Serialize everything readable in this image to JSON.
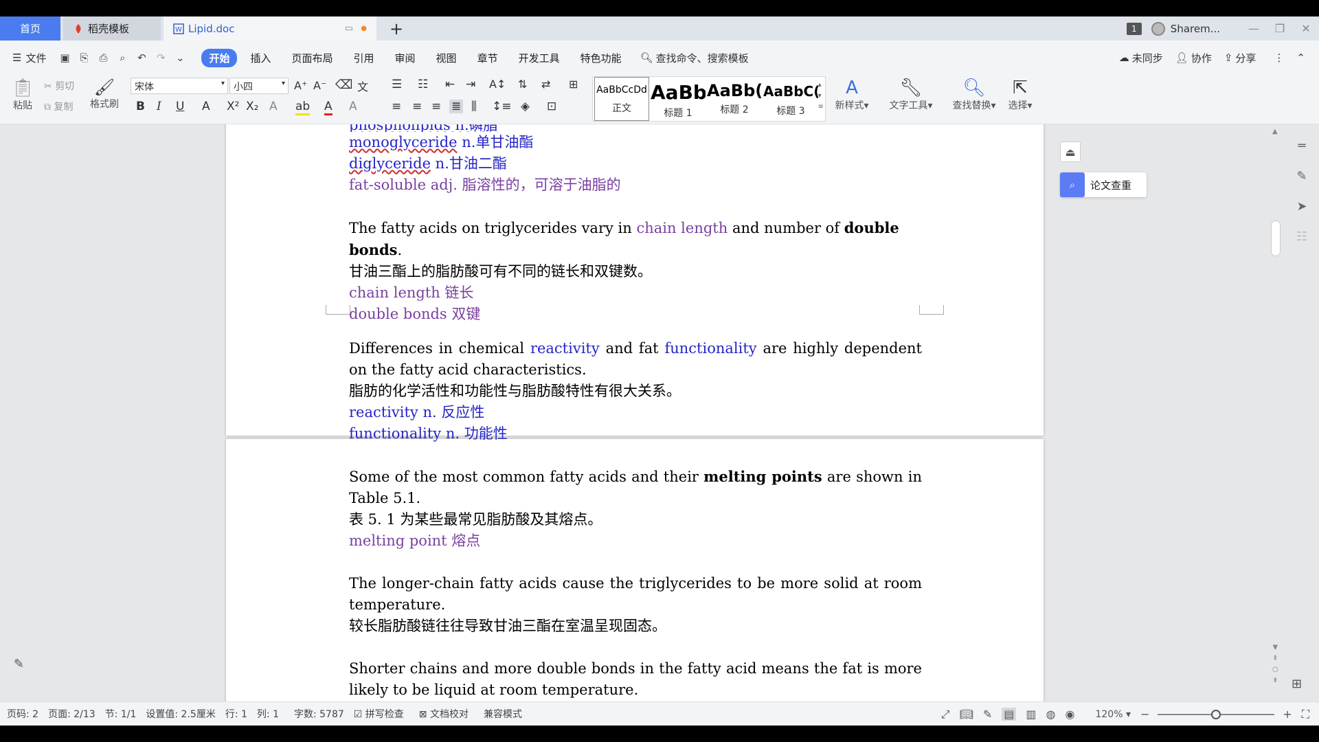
{
  "tabs": {
    "home": "首页",
    "template": "稻壳模板",
    "doc": "Lipid.doc",
    "add": "+"
  },
  "window": {
    "badge": "1",
    "user": "Sharem...",
    "minimize": "—",
    "restore": "❐",
    "close": "✕"
  },
  "menu": {
    "file": "文件",
    "items": [
      "开始",
      "插入",
      "页面布局",
      "引用",
      "审阅",
      "视图",
      "章节",
      "开发工具",
      "特色功能"
    ],
    "search": "查找命令、搜索模板",
    "sync": "未同步",
    "collab": "协作",
    "share": "分享"
  },
  "ribbon": {
    "paste": "粘贴",
    "cut": "剪切",
    "copy": "复制",
    "format_painter": "格式刷",
    "font_name": "宋体",
    "font_size": "小四",
    "styles": [
      {
        "preview": "AaBbCcDd",
        "name": "正文"
      },
      {
        "preview": "AaBb",
        "name": "标题 1"
      },
      {
        "preview": "AaBb(",
        "name": "标题 2"
      },
      {
        "preview": "AaBbC(",
        "name": "标题 3"
      }
    ],
    "new_style": "新样式",
    "text_tools": "文字工具",
    "find_replace": "查找替换",
    "select": "选择"
  },
  "document": {
    "top_partial": "phospholipids n.磷脂",
    "p1": [
      {
        "en": "monoglyceride",
        "rest": " n.单甘油酯"
      },
      {
        "en": "diglyceride",
        "rest": " n.甘油二酯"
      }
    ],
    "fat_soluble": "fat-soluble adj.  脂溶性的，可溶于油脂的",
    "s1_a": "The fatty acids on triglycerides vary in ",
    "s1_b": "chain length",
    "s1_c": " and number of ",
    "s1_d": "double bonds",
    "s1_e": ".",
    "s1_cn": "甘油三酯上的脂肪酸可有不同的链长和双键数。",
    "s1_t1": "chain length  链长",
    "s1_t2": "double bonds  双键",
    "s2_a": "Differences in chemical ",
    "s2_b": "reactivity",
    "s2_c": " and fat ",
    "s2_d": "functionality",
    "s2_e": " are highly dependent on the fatty acid characteristics.",
    "s2_cn": "脂肪的化学活性和功能性与脂肪酸特性有很大关系。",
    "s2_t1": "reactivity n.  反应性",
    "s2_t2": "functionality n.  功能性",
    "s3_a": "Some of the most common fatty acids and their ",
    "s3_b": "melting points",
    "s3_c": " are shown in Table 5.1.",
    "s3_cn": "表 5. 1 为某些最常见脂肪酸及其熔点。",
    "s3_t1": "melting point  熔点",
    "s4": "The longer-chain fatty acids cause the triglycerides to be more solid at room temperature.",
    "s4_cn": "较长脂肪酸链往往导致甘油三酯在室温呈现固态。",
    "s5": "Shorter chains and more double bonds in the fatty acid means the fat is more likely to be liquid at room temperature."
  },
  "side": {
    "paper_check": "论文查重"
  },
  "status": {
    "page_code": "页码: 2",
    "page": "页面: 2/13",
    "section": "节: 1/1",
    "setting": "设置值: 2.5厘米",
    "row": "行: 1",
    "col": "列: 1",
    "words": "字数: 5787",
    "spell": "拼写检查",
    "proof": "文档校对",
    "compat": "兼容模式",
    "zoom": "120%",
    "zoom_level": 0.5
  }
}
